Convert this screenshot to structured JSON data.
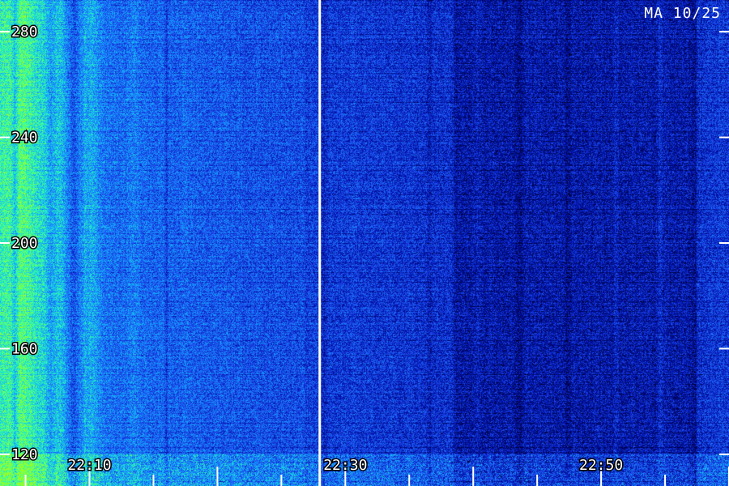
{
  "stamp": "MA 10/25",
  "chart_data": {
    "type": "heatmap",
    "title": "",
    "xlabel": "",
    "ylabel": "",
    "x_tick_labels": [
      "22:10",
      "22:30",
      "22:50"
    ],
    "y_tick_labels": [
      "280",
      "240",
      "200",
      "160",
      "120"
    ],
    "y_ticks": [
      280,
      240,
      200,
      160,
      120
    ],
    "ylim": [
      108,
      292
    ],
    "x_tick_times": [
      "22:10",
      "22:30",
      "22:50"
    ],
    "xlim": [
      "22:03",
      "23:00"
    ],
    "separator_time": "22:28",
    "colormap": [
      "#000033",
      "#0011aa",
      "#1f4ff0",
      "#13a8ff",
      "#2bffb0",
      "#9cff20"
    ],
    "grid": false,
    "legend": "none"
  }
}
